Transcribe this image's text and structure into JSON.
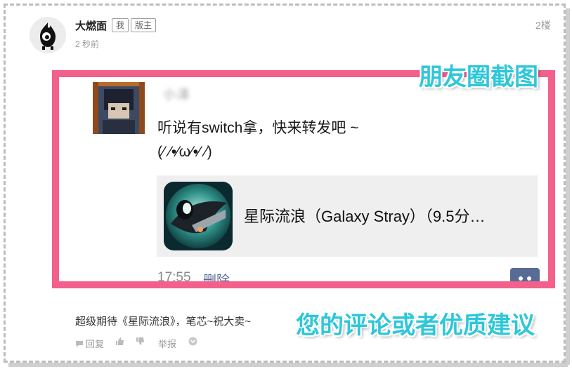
{
  "post": {
    "username": "大燃面",
    "badges": [
      "我",
      "版主"
    ],
    "time_ago": "2 秒前",
    "floor": "2楼",
    "comment": "超级期待《星际流浪》，笔芯~祝大卖~"
  },
  "moments": {
    "poster_name": "小泽",
    "text_line1": "听说有switch拿，快来转发吧 ~",
    "text_line2": "(⁄ ⁄•⁄ω⁄•⁄ ⁄)",
    "link_title": "星际流浪（Galaxy Stray）（9.5分…",
    "time": "17:55",
    "delete_label": "删除",
    "border_color": "#f4608c",
    "link_color": "#576b95"
  },
  "annotations": {
    "moments_label": "朋友圈截图",
    "suggestion_label": "您的评论或者优质建议",
    "color": "#2ec7d9"
  },
  "actions": {
    "reply": "回复",
    "report": "举报"
  }
}
